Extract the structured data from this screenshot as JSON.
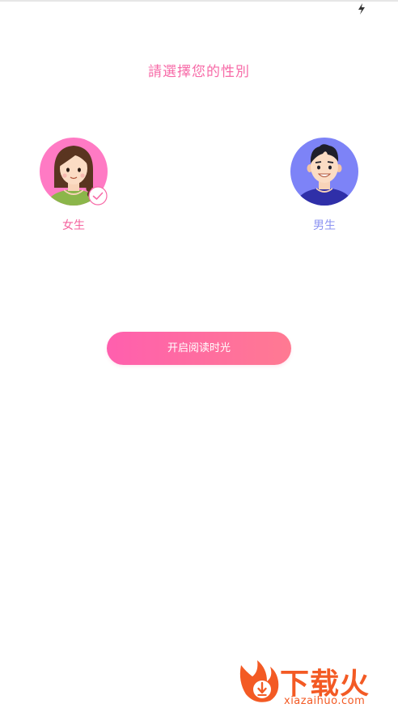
{
  "status_bar": {
    "icon": "flash-icon"
  },
  "title": "請選擇您的性別",
  "options": [
    {
      "label": "女生",
      "avatar": "female-avatar-icon",
      "selected": true
    },
    {
      "label": "男生",
      "avatar": "male-avatar-icon",
      "selected": false
    }
  ],
  "start_button_label": "开启阅读时光",
  "watermark": {
    "brand": "下载火",
    "domain": "xiazaihuo.com"
  },
  "colors": {
    "accent_pink": "#f76aa7",
    "female_circle": "#ff7ac4",
    "male_circle": "#7d83f7",
    "button_start": "#ff5fae",
    "button_end": "#ff7a92",
    "watermark": "#f35a24"
  }
}
